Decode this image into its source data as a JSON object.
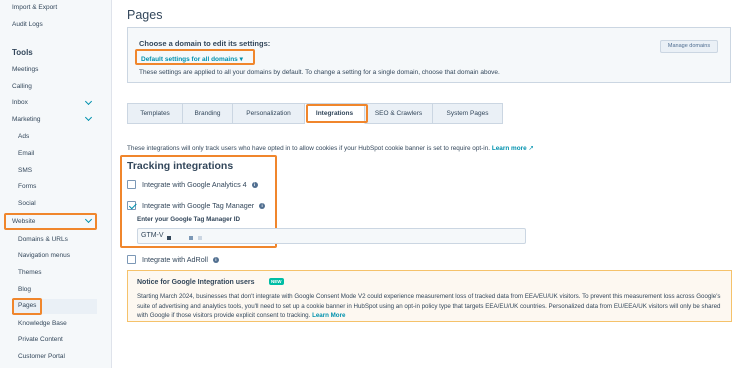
{
  "sidebar": {
    "top_items": [
      "Import & Export",
      "Audit Logs"
    ],
    "tools_heading": "Tools",
    "tools_items": [
      "Meetings",
      "Calling",
      "Inbox",
      "Marketing"
    ],
    "marketing_sub": [
      "Ads",
      "Email",
      "SMS",
      "Forms",
      "Social"
    ],
    "website_label": "Website",
    "website_sub": [
      "Domains & URLs",
      "Navigation menus",
      "Themes",
      "Blog",
      "Pages",
      "Knowledge Base",
      "Private Content",
      "Customer Portal"
    ]
  },
  "page": {
    "title": "Pages"
  },
  "domain": {
    "heading": "Choose a domain to edit its settings:",
    "selected": "Default settings for all domains",
    "note": "These settings are applied to all your domains by default. To change a setting for a single domain, choose that domain above.",
    "manage_button": "Manage domains"
  },
  "tabs": [
    "Templates",
    "Branding",
    "Personalization",
    "Integrations",
    "SEO & Crawlers",
    "System Pages"
  ],
  "integrations": {
    "info": "These integrations will only track users who have opted in to allow cookies if your HubSpot cookie banner is set to require opt-in.",
    "learn_more": "Learn more",
    "tracking_title": "Tracking integrations",
    "ga4_label": "Integrate with Google Analytics 4",
    "gtm_label": "Integrate with Google Tag Manager",
    "gtm_id_label": "Enter your Google Tag Manager ID",
    "gtm_value": "GTM-V",
    "adroll_label": "Integrate with AdRoll"
  },
  "notice": {
    "title": "Notice for Google Integration users",
    "badge": "NEW",
    "body": "Starting March 2024, businesses that don't integrate with Google Consent Mode V2 could experience measurement loss of tracked data from EEA/EU/UK visitors. To prevent this measurement loss across Google's suite of advertising and analytics tools, you'll need to set up a cookie banner in HubSpot using an opt-in policy type that targets EEA/EU/UK countries. Personalized data from EU/EEA/UK visitors will only be shared with Google if those visitors provide explicit consent to tracking.",
    "learn_more": "Learn More"
  },
  "colors": {
    "accent": "#0091ae",
    "highlight": "#f0862c",
    "text": "#33475b"
  }
}
